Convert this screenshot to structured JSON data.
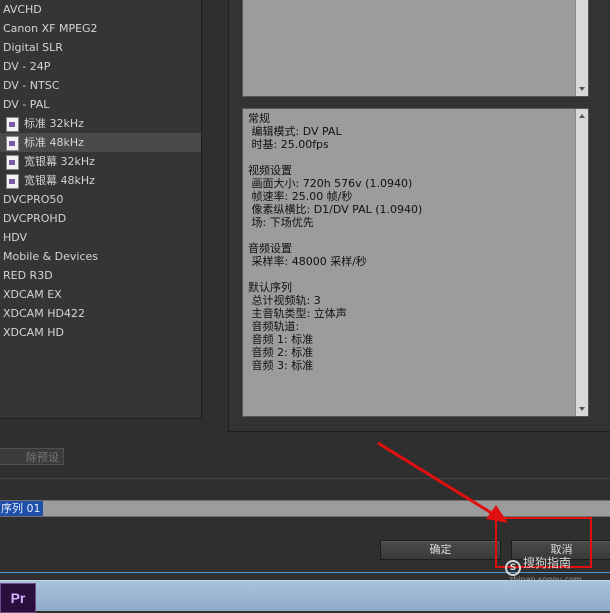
{
  "presets": [
    {
      "label": "AVCHD",
      "sub": false
    },
    {
      "label": "Canon XF MPEG2",
      "sub": false
    },
    {
      "label": "Digital SLR",
      "sub": false
    },
    {
      "label": "DV - 24P",
      "sub": false
    },
    {
      "label": "DV - NTSC",
      "sub": false
    },
    {
      "label": "DV - PAL",
      "sub": false
    },
    {
      "label": "标准 32kHz",
      "sub": true
    },
    {
      "label": "标准 48kHz",
      "sub": true,
      "selected": true
    },
    {
      "label": "宽银幕 32kHz",
      "sub": true
    },
    {
      "label": "宽银幕 48kHz",
      "sub": true
    },
    {
      "label": "DVCPRO50",
      "sub": false
    },
    {
      "label": "DVCPROHD",
      "sub": false
    },
    {
      "label": "HDV",
      "sub": false
    },
    {
      "label": "Mobile & Devices",
      "sub": false
    },
    {
      "label": "RED R3D",
      "sub": false
    },
    {
      "label": "XDCAM EX",
      "sub": false
    },
    {
      "label": "XDCAM HD422",
      "sub": false
    },
    {
      "label": "XDCAM HD",
      "sub": false
    }
  ],
  "description": "常规\n 编辑模式: DV PAL\n 时基: 25.00fps\n\n视频设置\n 画面大小: 720h 576v (1.0940)\n 帧速率: 25.00 帧/秒\n 像素纵横比: D1/DV PAL (1.0940)\n 场: 下场优先\n\n音频设置\n 采样率: 48000 采样/秒\n\n默认序列\n 总计视频轨: 3\n 主音轨类型: 立体声\n 音频轨道:\n 音频 1: 标准\n 音频 2: 标准\n 音频 3: 标准",
  "delete_preset_label": "除预设",
  "sequence_name": "序列 01",
  "buttons": {
    "ok": "确定",
    "cancel": "取消"
  },
  "watermark": {
    "text": "搜狗指南",
    "url": "zhinan.sogou.com"
  },
  "taskbar": {
    "premiere_icon": "Pr"
  },
  "colors": {
    "annotation_red": "#e01010",
    "selection_blue": "#1f4fa8"
  }
}
